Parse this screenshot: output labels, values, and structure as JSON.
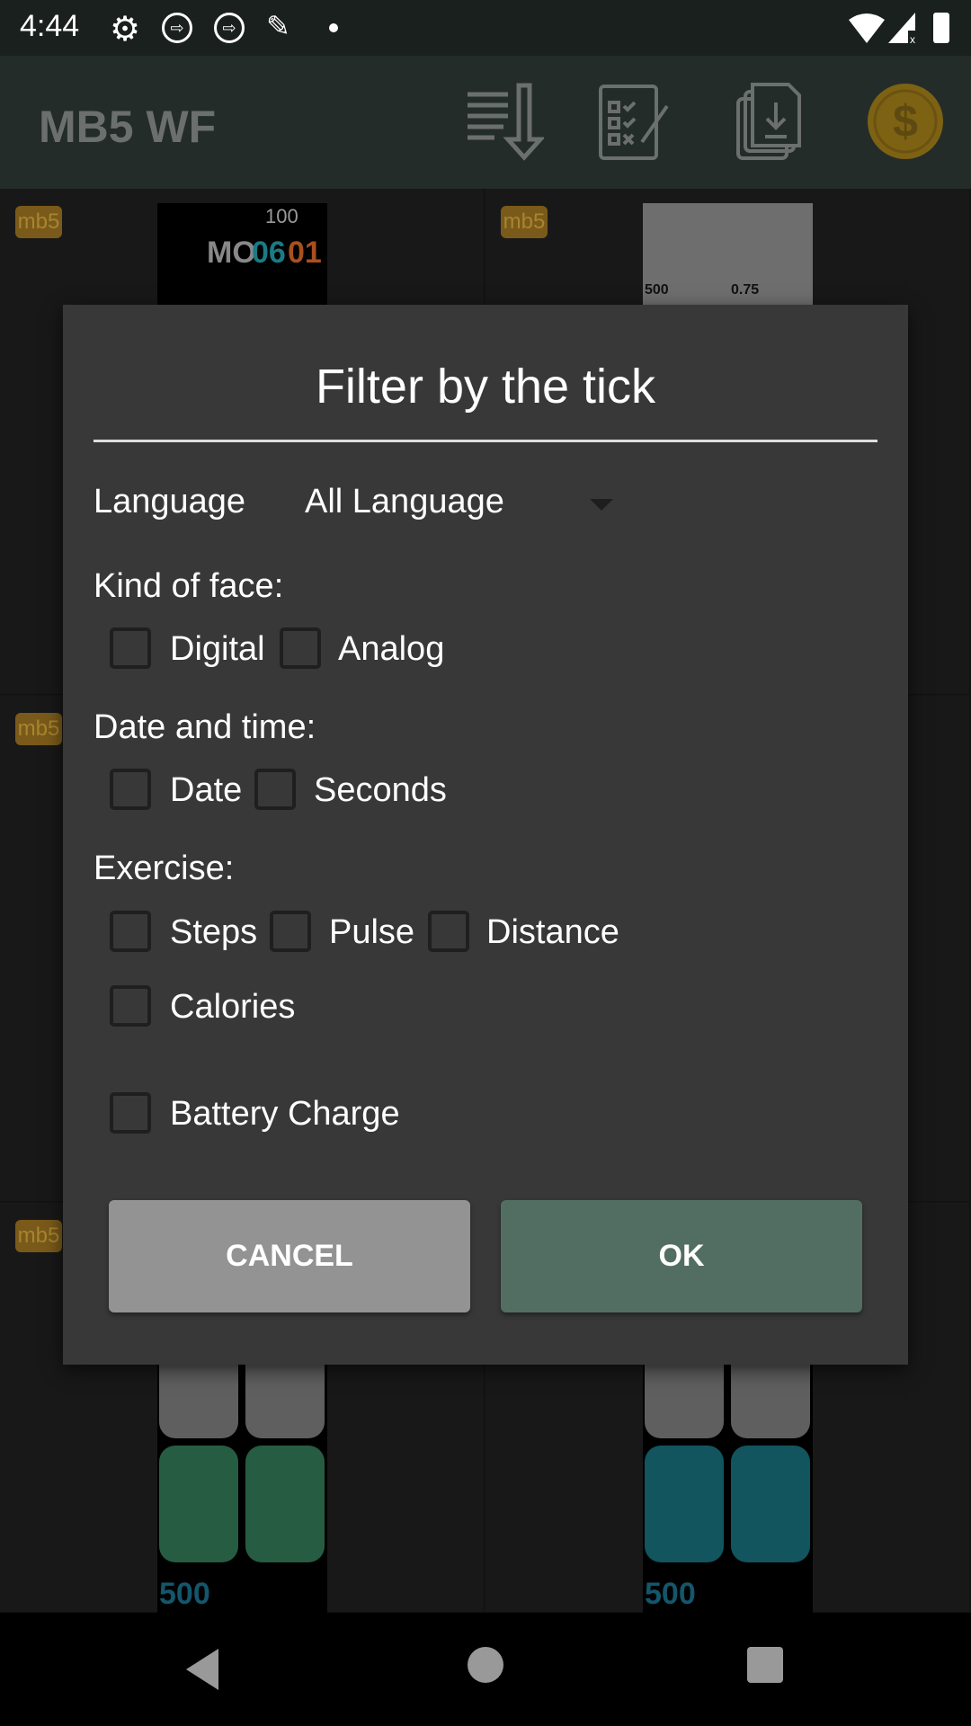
{
  "status_bar": {
    "time": "4:44",
    "icons": [
      "gear-icon",
      "cast-icon",
      "cast-icon",
      "usb-debug-icon",
      "dot-icon",
      "wifi-icon",
      "signal-icon",
      "battery-icon"
    ]
  },
  "app_bar": {
    "title": "MB5 WF",
    "actions": [
      "sort-download-icon",
      "checklist-icon",
      "files-download-icon",
      "coin-dollar-icon"
    ],
    "coin_color": "#7d6214"
  },
  "grid": {
    "badge": "mb5",
    "face1": {
      "battery": "100",
      "day": "MO",
      "date_a": "06",
      "date_b": "01"
    },
    "face2": {
      "steps": "500",
      "distance": "0.75"
    },
    "face_bottom_steps": "500"
  },
  "dialog": {
    "title": "Filter by the tick",
    "language": {
      "label": "Language",
      "value": "All Language"
    },
    "kind_of_face": {
      "label": "Kind of face:",
      "options": [
        {
          "label": "Digital",
          "checked": false
        },
        {
          "label": "Analog",
          "checked": false
        }
      ]
    },
    "date_time": {
      "label": "Date and time:",
      "options": [
        {
          "label": "Date",
          "checked": false
        },
        {
          "label": "Seconds",
          "checked": false
        }
      ]
    },
    "exercise": {
      "label": "Exercise:",
      "options": [
        {
          "label": "Steps",
          "checked": false
        },
        {
          "label": "Pulse",
          "checked": false
        },
        {
          "label": "Distance",
          "checked": false
        },
        {
          "label": "Calories",
          "checked": false
        }
      ]
    },
    "battery": {
      "label": "Battery Charge",
      "checked": false
    },
    "cancel_label": "CANCEL",
    "ok_label": "OK",
    "colors": {
      "cancel": "#939393",
      "ok": "#526e62",
      "background": "#383838"
    }
  }
}
